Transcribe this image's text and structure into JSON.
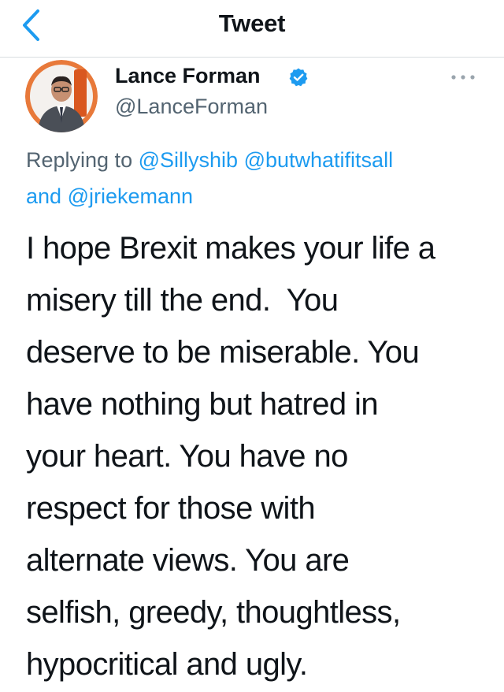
{
  "nav": {
    "title": "Tweet",
    "back_icon": "chevron-left-icon"
  },
  "tweet": {
    "author": {
      "display_name": "Lance Forman",
      "handle": "@LanceForman",
      "verified": true
    },
    "replying_prefix": "Replying to",
    "replying_to": [
      "@Sillyshib",
      "@butwhatifitsall",
      "@jriekemann"
    ],
    "replying_joiner": "and",
    "body_lines": [
      "I hope Brexit makes your life a",
      "misery till the end.  You",
      "deserve to be miserable. You",
      "have nothing but hatred in",
      "your heart. You have no",
      "respect for those with",
      "alternate views. You are",
      "selfish, greedy, thoughtless,",
      "hypocritical and ugly."
    ]
  },
  "colors": {
    "accent": "#1d9bf0",
    "text": "#0f1419",
    "secondary": "#536471",
    "avatar_ring": "#e8793a"
  }
}
